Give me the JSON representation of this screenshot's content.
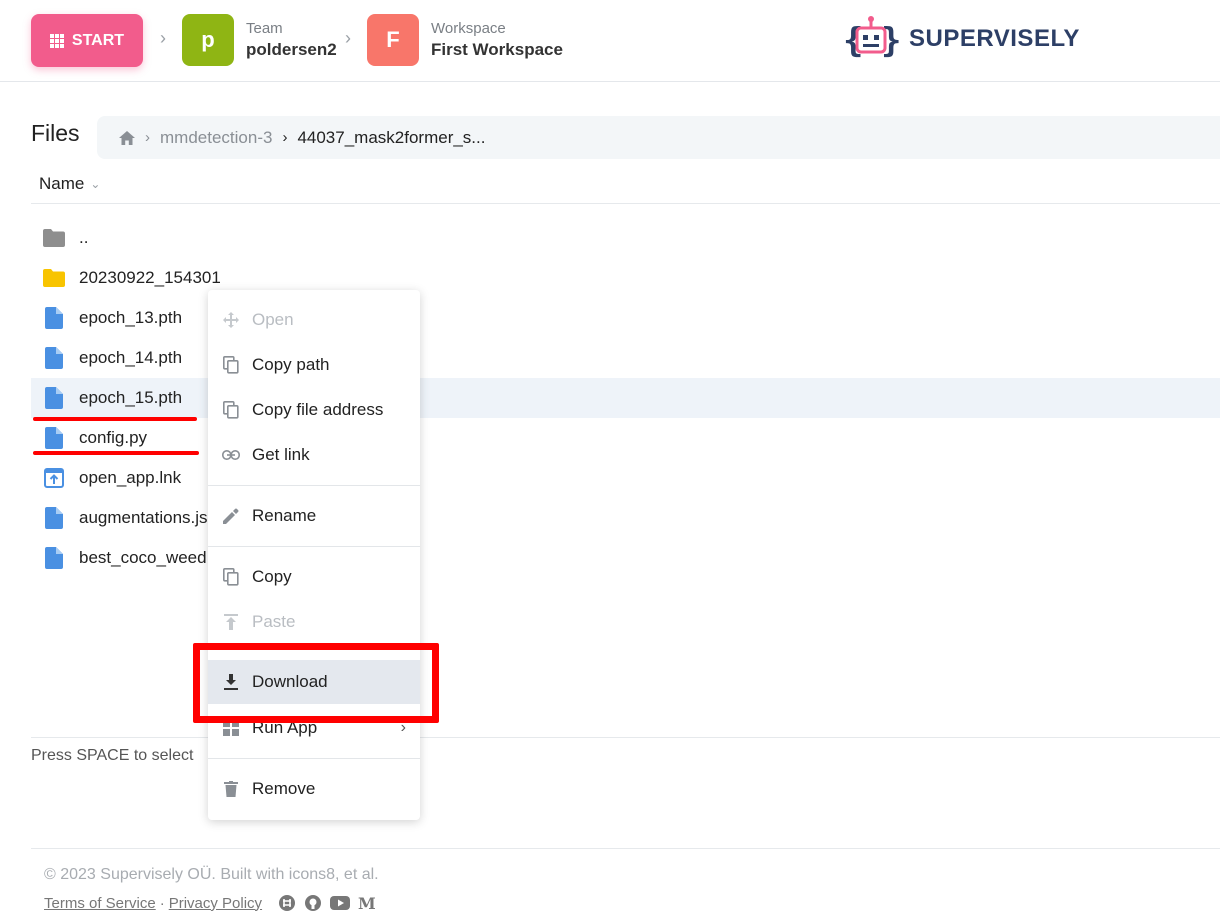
{
  "header": {
    "start_label": "START",
    "team": {
      "avatar_letter": "p",
      "caption": "Team",
      "name": "poldersen2",
      "color": "#8fb514"
    },
    "workspace": {
      "avatar_letter": "F",
      "caption": "Workspace",
      "name": "First Workspace",
      "color": "#f8766a"
    },
    "brand": "SUPERVISELY",
    "start_color": "#f25c8c"
  },
  "files": {
    "title": "Files",
    "breadcrumb": [
      "mmdetection-3",
      "44037_mask2former_s..."
    ],
    "column_name": "Name",
    "rows": [
      {
        "label": "..",
        "icon": "folder-gray-icon"
      },
      {
        "label": "20230922_154301",
        "icon": "folder-yellow-icon"
      },
      {
        "label": "epoch_13.pth",
        "icon": "file-icon"
      },
      {
        "label": "epoch_14.pth",
        "icon": "file-icon"
      },
      {
        "label": "epoch_15.pth",
        "icon": "file-icon"
      },
      {
        "label": "config.py",
        "icon": "file-icon"
      },
      {
        "label": "open_app.lnk",
        "icon": "app-link-icon"
      },
      {
        "label": "augmentations.js",
        "icon": "file-icon"
      },
      {
        "label": "best_coco_weed",
        "icon": "file-icon"
      }
    ],
    "hint": "Press SPACE to select"
  },
  "context_menu": {
    "items": [
      {
        "label": "Open",
        "icon": "move-icon",
        "disabled": true
      },
      {
        "label": "Copy path",
        "icon": "copy-icon"
      },
      {
        "label": "Copy file address",
        "icon": "copy-icon"
      },
      {
        "label": "Get link",
        "icon": "link-icon"
      },
      {
        "label": "Rename",
        "icon": "pencil-icon"
      },
      {
        "label": "Copy",
        "icon": "copy-icon"
      },
      {
        "label": "Paste",
        "icon": "paste-icon",
        "disabled": true
      },
      {
        "label": "Download",
        "icon": "download-icon"
      },
      {
        "label": "Run App",
        "icon": "apps-icon"
      },
      {
        "label": "Remove",
        "icon": "trash-icon"
      }
    ]
  },
  "footer": {
    "copyright": "© 2023 Supervisely OÜ. Built with icons8, et al.",
    "terms": "Terms of Service",
    "separator": "·",
    "privacy": "Privacy Policy"
  },
  "colors": {
    "folder_yellow": "#f8c400",
    "file_blue": "#4a90e2",
    "annotation_red": "#ff0000"
  }
}
